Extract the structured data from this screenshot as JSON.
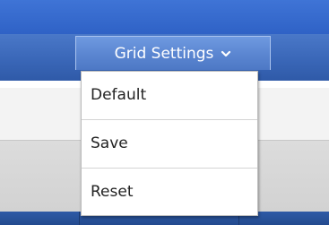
{
  "toolbar": {
    "grid_settings_label": "Grid Settings",
    "chevron_icon": "chevron-down-icon"
  },
  "menu": {
    "items": [
      {
        "label": "Default"
      },
      {
        "label": "Save"
      },
      {
        "label": "Reset"
      }
    ]
  },
  "colors": {
    "toolbar_blue": "#3a67b8",
    "button_blue": "#5c87d2",
    "menu_bg": "#ffffff",
    "menu_text": "#222222"
  }
}
